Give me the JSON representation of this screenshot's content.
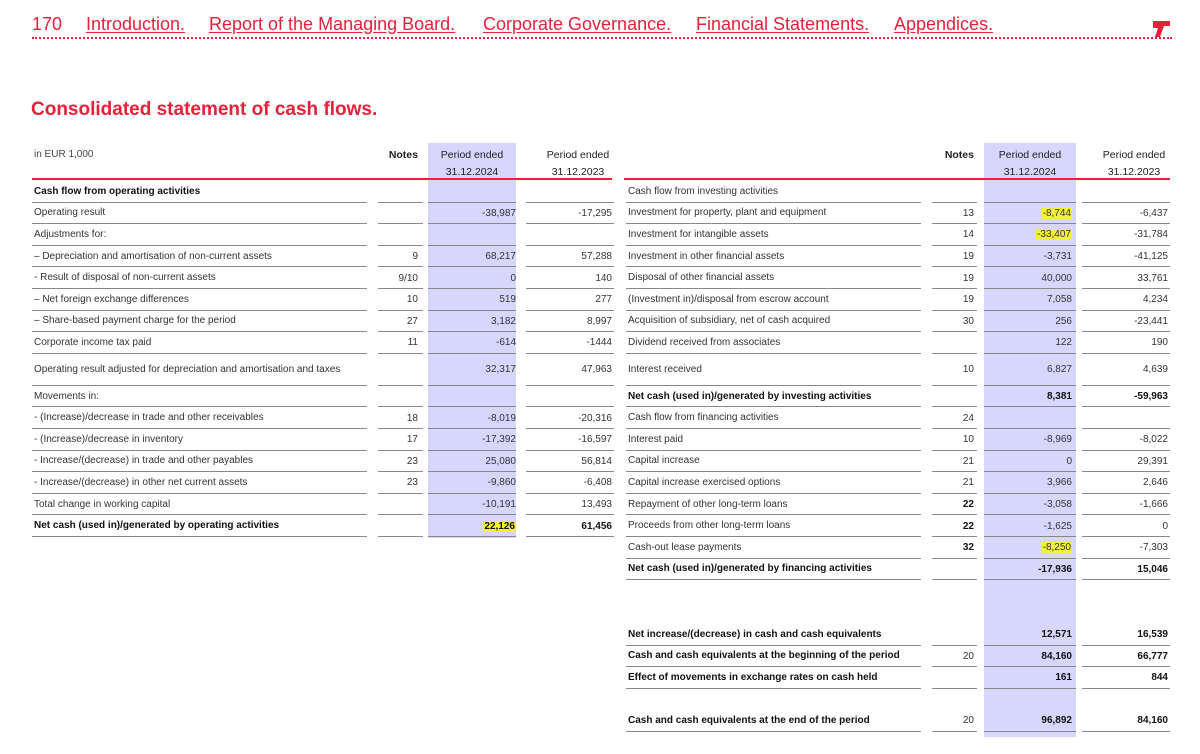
{
  "nav": {
    "page_number": "170",
    "links": [
      "Introduction.",
      "Report of the Managing Board.",
      "Corporate Governance.",
      "Financial Statements.",
      "Appendices."
    ]
  },
  "logo_icon": "brand-logo-icon",
  "accent_color": "#e8203a",
  "highlight_column_color": "#d6d6ff",
  "highlight_marker_color": "#f3f03a",
  "title": "Consolidated statement of cash flows.",
  "left": {
    "unit_label": "in EUR 1,000",
    "notes_header": "Notes",
    "col1_header": [
      "Period ended",
      "31.12.2024"
    ],
    "col2_header": [
      "Period ended",
      "31.12.2023"
    ],
    "rows": [
      {
        "label": "Cash flow from operating activities",
        "note": "",
        "v1": "",
        "v2": "",
        "bold": true
      },
      {
        "label": "Operating result",
        "note": "",
        "v1": "-38,987",
        "v2": "-17,295"
      },
      {
        "label": "Adjustments for:",
        "note": "",
        "v1": "",
        "v2": ""
      },
      {
        "label": "–  Depreciation and amortisation of non-current assets",
        "note": "9",
        "v1": "68,217",
        "v2": "57,288"
      },
      {
        "label": "- Result of disposal of non-current assets",
        "note": "9/10",
        "v1": "0",
        "v2": "140"
      },
      {
        "label": "–  Net foreign exchange differences",
        "note": "10",
        "v1": "519",
        "v2": "277"
      },
      {
        "label": "–  Share-based payment charge for the period",
        "note": "27",
        "v1": "3,182",
        "v2": "8,997"
      },
      {
        "label": "Corporate income tax paid",
        "note": "11",
        "v1": "-614",
        "v2": "-1444"
      },
      {
        "label": "Operating result adjusted for depreciation and amortisation and taxes",
        "note": "",
        "v1": "32,317",
        "v2": "47,963",
        "tall": true
      },
      {
        "label": "Movements in:",
        "note": "",
        "v1": "",
        "v2": ""
      },
      {
        "label": "- (Increase)/decrease in trade and other receivables",
        "note": "18",
        "v1": "-8,019",
        "v2": "-20,316"
      },
      {
        "label": "- (Increase)/decrease in inventory",
        "note": "17",
        "v1": "-17,392",
        "v2": "-16,597"
      },
      {
        "label": "- Increase/(decrease) in trade and other payables",
        "note": "23",
        "v1": "25,080",
        "v2": "56,814"
      },
      {
        "label": "- Increase/(decrease) in other net current assets",
        "note": "23",
        "v1": "-9,860",
        "v2": "-6,408"
      },
      {
        "label": "Total change in working capital",
        "note": "",
        "v1": "-10,191",
        "v2": "13,493"
      },
      {
        "label": "Net cash (used in)/generated by operating activities",
        "note": "",
        "v1": "22,126",
        "v2": "61,456",
        "bold": true,
        "hl": true
      }
    ]
  },
  "right": {
    "notes_header": "Notes",
    "col1_header": [
      "Period ended",
      "31.12.2024"
    ],
    "col2_header": [
      "Period ended",
      "31.12.2023"
    ],
    "rows": [
      {
        "label": "Cash flow from investing activities",
        "note": "",
        "v1": "",
        "v2": ""
      },
      {
        "label": "Investment for property, plant and equipment",
        "note": "13",
        "v1": "-8,744",
        "v2": "-6,437",
        "hl": true
      },
      {
        "label": "Investment for intangible assets",
        "note": "14",
        "v1": "-33,407",
        "v2": "-31,784",
        "hl": true
      },
      {
        "label": "Investment in other financial assets",
        "note": "19",
        "v1": "-3,731",
        "v2": "-41,125"
      },
      {
        "label": "Disposal of other financial assets",
        "note": "19",
        "v1": "40,000",
        "v2": "33,761"
      },
      {
        "label": "(Investment in)/disposal from escrow account",
        "note": "19",
        "v1": "7,058",
        "v2": "4,234"
      },
      {
        "label": "Acquisition of subsidiary, net of cash acquired",
        "note": "30",
        "v1": "256",
        "v2": "-23,441"
      },
      {
        "label": "Dividend received from associates",
        "note": "",
        "v1": "122",
        "v2": "190"
      },
      {
        "label": "Interest received",
        "note": "10",
        "v1": "6,827",
        "v2": "4,639",
        "tall": true
      },
      {
        "label": "Net cash (used in)/generated by investing activities",
        "note": "",
        "v1": "8,381",
        "v2": "-59,963",
        "bold": true
      },
      {
        "label": "Cash flow from financing activities",
        "note": "24",
        "v1": "",
        "v2": ""
      },
      {
        "label": "Interest paid",
        "note": "10",
        "v1": "-8,969",
        "v2": "-8,022"
      },
      {
        "label": "Capital increase",
        "note": "21",
        "v1": "0",
        "v2": "29,391"
      },
      {
        "label": "Capital increase exercised options",
        "note": "21",
        "v1": "3,966",
        "v2": "2,646"
      },
      {
        "label": "Repayment of other long-term loans",
        "note": "22",
        "v1": "-3,058",
        "v2": "-1,666",
        "boldnote": true
      },
      {
        "label": "Proceeds from other long-term loans",
        "note": "22",
        "v1": "-1,625",
        "v2": "0",
        "boldnote": true
      },
      {
        "label": "Cash-out lease payments",
        "note": "32",
        "v1": "-8,250",
        "v2": "-7,303",
        "boldnote": true,
        "hl": true
      },
      {
        "label": "Net cash (used in)/generated by financing activities",
        "note": "",
        "v1": "-17,936",
        "v2": "15,046",
        "bold": true
      }
    ],
    "summary": [
      {
        "label": "Net increase/(decrease) in cash and cash equivalents",
        "note": "",
        "v1": "12,571",
        "v2": "16,539",
        "bold": true
      },
      {
        "label": "Cash and cash equivalents at the beginning of the period",
        "note": "20",
        "v1": "84,160",
        "v2": "66,777",
        "bold": true
      },
      {
        "label": "Effect of movements in exchange rates on cash held",
        "note": "",
        "v1": "161",
        "v2": "844",
        "bold": true
      }
    ],
    "final": {
      "label": "Cash and cash equivalents at the end of the period",
      "note": "20",
      "v1": "96,892",
      "v2": "84,160",
      "bold": true
    }
  }
}
